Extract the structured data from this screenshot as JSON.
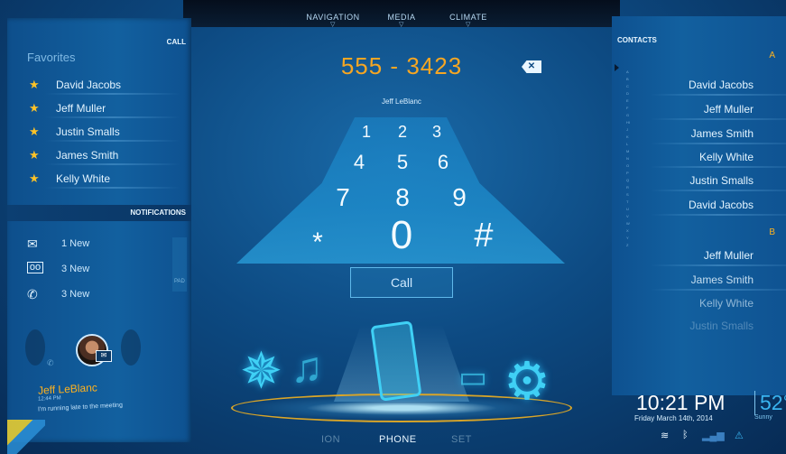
{
  "top_tabs": [
    {
      "label": "NAVIGATION"
    },
    {
      "label": "MEDIA"
    },
    {
      "label": "CLIMATE"
    }
  ],
  "call_panel": {
    "header": "CALL",
    "favorites_title": "Favorites",
    "favorites": [
      "David Jacobs",
      "Jeff Muller",
      "Justin Smalls",
      "James Smith",
      "Kelly White"
    ]
  },
  "notifications": {
    "header": "NOTIFICATIONS",
    "items": [
      {
        "icon": "envelope-icon",
        "label": "1 New"
      },
      {
        "icon": "voicemail-icon",
        "label": "3 New"
      },
      {
        "icon": "missed-call-icon",
        "label": "3 New"
      }
    ],
    "pad_label": "PAD",
    "message": {
      "name": "Jeff LeBlanc",
      "time": "12:44 PM",
      "text": "I'm running late to the meeting"
    }
  },
  "dialer": {
    "number": "555 - 3423",
    "contact_name": "Jeff LeBlanc",
    "keys": [
      "1",
      "2",
      "3",
      "4",
      "5",
      "6",
      "7",
      "8",
      "9",
      "*",
      "0",
      "#"
    ],
    "call_label": "Call"
  },
  "contacts": {
    "header": "CONTACTS",
    "groups": [
      {
        "letter": "A",
        "names": [
          "David Jacobs",
          "Jeff Muller",
          "James Smith",
          "Kelly White",
          "Justin Smalls",
          "David Jacobs"
        ]
      },
      {
        "letter": "B",
        "names": [
          "Jeff Muller",
          "James Smith",
          "Kelly White",
          "Justin Smalls"
        ]
      }
    ],
    "alpha_index": "ABCDEFGHIJKLMNOPQRSTUVWXYZ"
  },
  "status": {
    "time": "10:21 PM",
    "temperature": "52°",
    "date": "Friday March 14th, 2014",
    "condition": "Sunny"
  },
  "bottom_tabs": [
    {
      "label": "ION"
    },
    {
      "label": "PHONE"
    },
    {
      "label": "SET"
    }
  ],
  "colors": {
    "accent_orange": "#f5a623",
    "star_yellow": "#ffc327",
    "icon_cyan": "#3fd0f5"
  }
}
